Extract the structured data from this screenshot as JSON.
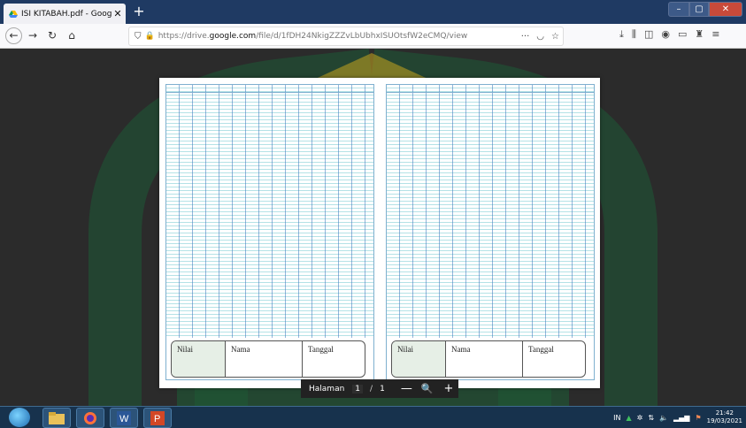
{
  "browser": {
    "tab_title": "ISI KITABAH.pdf - Google Drive",
    "url_prefix": "https://drive.",
    "url_domain": "google.com",
    "url_path": "/file/d/1fDH24NkigZZZvLbUbhxISUOtsfW2eCMQ/view",
    "url_more": "···"
  },
  "document": {
    "left_page": {
      "col1": "Nilai",
      "col2": "Nama",
      "col3": "Tanggal"
    },
    "right_page": {
      "col1": "Nilai",
      "col2": "Nama",
      "col3": "Tanggal"
    }
  },
  "page_toolbar": {
    "label": "Halaman",
    "current_page": "1",
    "separator": "/",
    "total_pages": "1",
    "zoom_out": "—",
    "zoom_in": "+"
  },
  "taskbar": {
    "lang": "IN",
    "time": "21:42",
    "date": "19/03/2021"
  },
  "colors": {
    "grid_vertical": "#3c78be",
    "grid_horizontal": "#5abec8",
    "watermark_green": "#1e6b3c",
    "watermark_yellow": "#e6c428"
  }
}
